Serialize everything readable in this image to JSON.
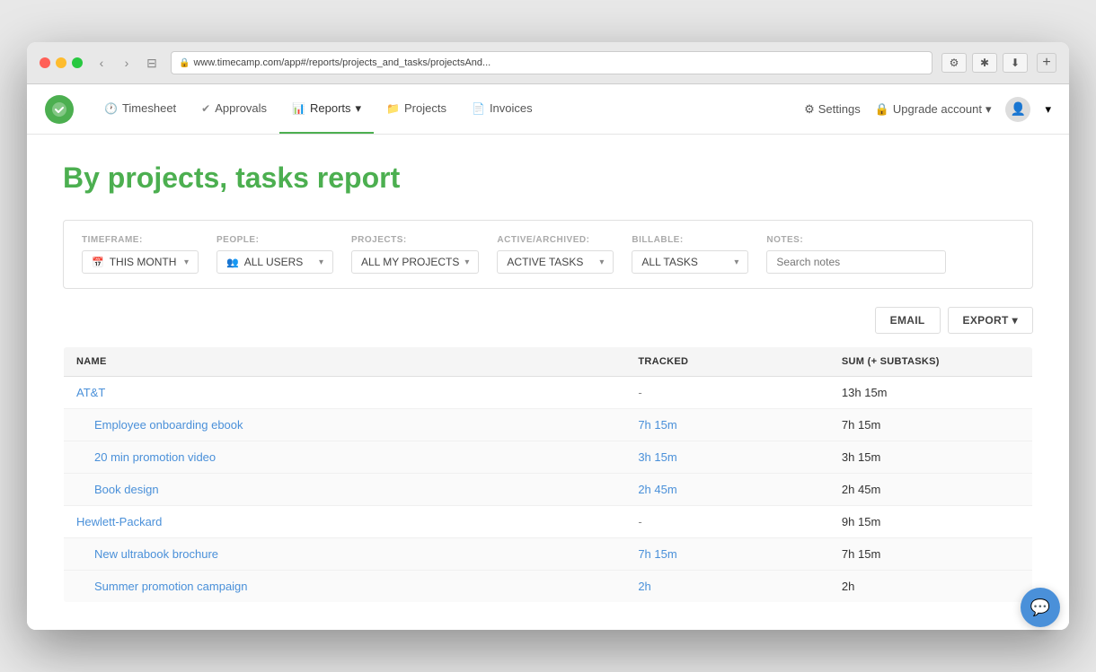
{
  "browser": {
    "url": "www.timecamp.com/app#/reports/projects_and_tasks/projectsAnd...",
    "add_tab_label": "+"
  },
  "nav": {
    "logo_icon": "✓",
    "timesheet_label": "Timesheet",
    "timesheet_icon": "🕐",
    "approvals_label": "Approvals",
    "approvals_icon": "✔",
    "reports_label": "Reports",
    "reports_icon": "📊",
    "reports_arrow": "▾",
    "projects_label": "Projects",
    "projects_icon": "📁",
    "invoices_label": "Invoices",
    "invoices_icon": "📄",
    "settings_label": "Settings",
    "settings_icon": "⚙",
    "upgrade_label": "Upgrade account",
    "upgrade_icon": "🔒",
    "upgrade_arrow": "▾",
    "user_icon": "👤"
  },
  "page": {
    "title": "By projects, tasks report"
  },
  "filters": {
    "timeframe_label": "TIMEFRAME:",
    "timeframe_icon": "📅",
    "timeframe_value": "THIS MONTH",
    "timeframe_arrow": "▾",
    "people_label": "PEOPLE:",
    "people_icon": "👥",
    "people_value": "ALL USERS",
    "people_arrow": "▾",
    "projects_label": "PROJECTS:",
    "projects_value": "ALL MY PROJECTS",
    "projects_arrow": "▾",
    "active_archived_label": "ACTIVE/ARCHIVED:",
    "active_archived_value": "ACTIVE TASKS",
    "active_archived_arrow": "▾",
    "billable_label": "BILLABLE:",
    "billable_value": "ALL TASKS",
    "billable_arrow": "▾",
    "notes_label": "NOTES:",
    "notes_placeholder": "Search notes"
  },
  "actions": {
    "email_label": "EMAIL",
    "export_label": "EXPORT",
    "export_arrow": "▾"
  },
  "table": {
    "col_name": "NAME",
    "col_tracked": "TRACKED",
    "col_sum": "SUM (+ SUBTASKS)",
    "rows": [
      {
        "type": "project",
        "name": "AT&T",
        "tracked": "-",
        "sum": "13h 15m"
      },
      {
        "type": "task",
        "name": "Employee onboarding ebook",
        "tracked": "7h 15m",
        "sum": "7h 15m"
      },
      {
        "type": "task",
        "name": "20 min promotion video",
        "tracked": "3h 15m",
        "sum": "3h 15m"
      },
      {
        "type": "task",
        "name": "Book design",
        "tracked": "2h 45m",
        "sum": "2h 45m"
      },
      {
        "type": "project",
        "name": "Hewlett-Packard",
        "tracked": "-",
        "sum": "9h 15m"
      },
      {
        "type": "task",
        "name": "New ultrabook brochure",
        "tracked": "7h 15m",
        "sum": "7h 15m"
      },
      {
        "type": "task",
        "name": "Summer promotion campaign",
        "tracked": "2h",
        "sum": "2h"
      }
    ]
  },
  "chat": {
    "icon": "💬"
  }
}
